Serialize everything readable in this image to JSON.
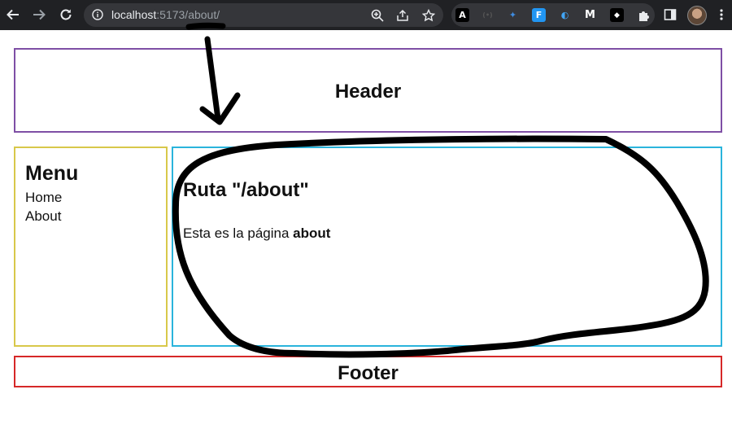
{
  "browser": {
    "url_host": "localhost",
    "url_path": ":5173/about/",
    "icons": [
      "back-arrow-icon",
      "forward-arrow-icon",
      "reload-icon",
      "info-icon",
      "zoom-icon",
      "share-icon",
      "star-icon",
      "extensions-puzzle-icon",
      "side-panel-icon",
      "profile-avatar",
      "kebab-menu-icon"
    ],
    "extensions": [
      "A",
      "(•)",
      "✦",
      "F",
      "◐",
      "M",
      "◆"
    ]
  },
  "header": {
    "title": "Header"
  },
  "menu": {
    "title": "Menu",
    "items": [
      {
        "label": "Home"
      },
      {
        "label": "About"
      }
    ]
  },
  "main": {
    "title": "Ruta \"/about\"",
    "text_prefix": "Esta es la página",
    "text_bold": "about"
  },
  "footer": {
    "title": "Footer"
  },
  "colors": {
    "header_border": "#7e4fa5",
    "menu_border": "#d8c84a",
    "main_border": "#2ab4dc",
    "footer_border": "#d62828",
    "annotation": "#000000"
  }
}
